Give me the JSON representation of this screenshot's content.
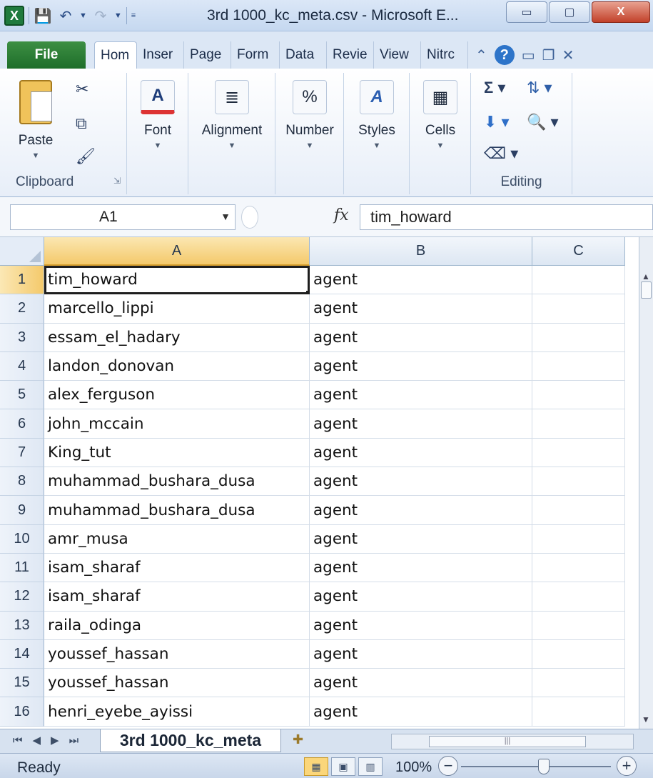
{
  "window": {
    "title": "3rd 1000_kc_meta.csv - Microsoft E...",
    "app_icon": "excel-icon",
    "controls": {
      "minimize": "▭",
      "maximize": "▢",
      "close": "X"
    }
  },
  "ribbon_tabs": [
    "File",
    "Hom",
    "Inser",
    "Page",
    "Form",
    "Data",
    "Revie",
    "View",
    "Nitrc"
  ],
  "ribbon_right_icons": [
    "caret-up-icon",
    "help-icon",
    "minimize-ribbon-icon",
    "restore-icon",
    "close-icon"
  ],
  "ribbon": {
    "clipboard": {
      "paste_label": "Paste",
      "group_label": "Clipboard"
    },
    "font": {
      "label": "Font"
    },
    "alignment": {
      "label": "Alignment"
    },
    "number": {
      "label": "Number",
      "symbol": "%"
    },
    "styles": {
      "label": "Styles"
    },
    "cells": {
      "label": "Cells"
    },
    "editing": {
      "group_label": "Editing"
    }
  },
  "formula_bar": {
    "name_box": "A1",
    "fx_label": "fx",
    "value": "tim_howard"
  },
  "grid": {
    "columns": [
      "A",
      "B",
      "C"
    ],
    "active_cell": "A1",
    "rows": [
      {
        "n": "1",
        "a": "tim_howard",
        "b": "agent"
      },
      {
        "n": "2",
        "a": "marcello_lippi",
        "b": "agent"
      },
      {
        "n": "3",
        "a": "essam_el_hadary",
        "b": "agent"
      },
      {
        "n": "4",
        "a": "landon_donovan",
        "b": "agent"
      },
      {
        "n": "5",
        "a": "alex_ferguson",
        "b": "agent"
      },
      {
        "n": "6",
        "a": "john_mccain",
        "b": "agent"
      },
      {
        "n": "7",
        "a": "King_tut",
        "b": "agent"
      },
      {
        "n": "8",
        "a": "muhammad_bushara_dusa",
        "b": "agent"
      },
      {
        "n": "9",
        "a": "muhammad_bushara_dusa",
        "b": "agent"
      },
      {
        "n": "10",
        "a": "amr_musa",
        "b": "agent"
      },
      {
        "n": "11",
        "a": "isam_sharaf",
        "b": "agent"
      },
      {
        "n": "12",
        "a": "isam_sharaf",
        "b": "agent"
      },
      {
        "n": "13",
        "a": "raila_odinga",
        "b": "agent"
      },
      {
        "n": "14",
        "a": "youssef_hassan",
        "b": "agent"
      },
      {
        "n": "15",
        "a": "youssef_hassan",
        "b": "agent"
      },
      {
        "n": "16",
        "a": "henri_eyebe_ayissi",
        "b": "agent"
      }
    ]
  },
  "sheet_tabs": {
    "active": "3rd 1000_kc_meta"
  },
  "status_bar": {
    "status": "Ready",
    "zoom": "100%",
    "zoom_level": 0.55
  }
}
